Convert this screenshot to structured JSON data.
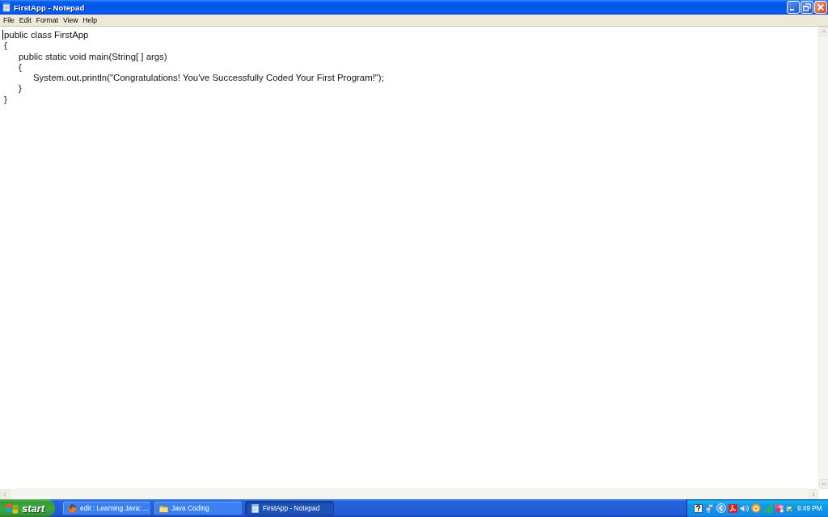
{
  "window": {
    "title": "FirstApp - Notepad"
  },
  "menu_bar": {
    "items": [
      "File",
      "Edit",
      "Format",
      "View",
      "Help"
    ]
  },
  "editor": {
    "text": "public class FirstApp\n{\n\tpublic static void main(String[ ] args)\n\t{\n\t\tSystem.out.println(\"Congratulations! You've Successfully Coded Your First Program!\");\n\t}\n}"
  },
  "taskbar": {
    "start_button": "start",
    "tasks": [
      {
        "label": "edit : Learning Java: ...",
        "kind": "browser",
        "selected": false
      },
      {
        "label": "Java Coding",
        "kind": "folder",
        "selected": false
      },
      {
        "label": "FirstApp - Notepad",
        "kind": "notepad",
        "selected": true
      }
    ],
    "clock": "9:49 PM"
  }
}
